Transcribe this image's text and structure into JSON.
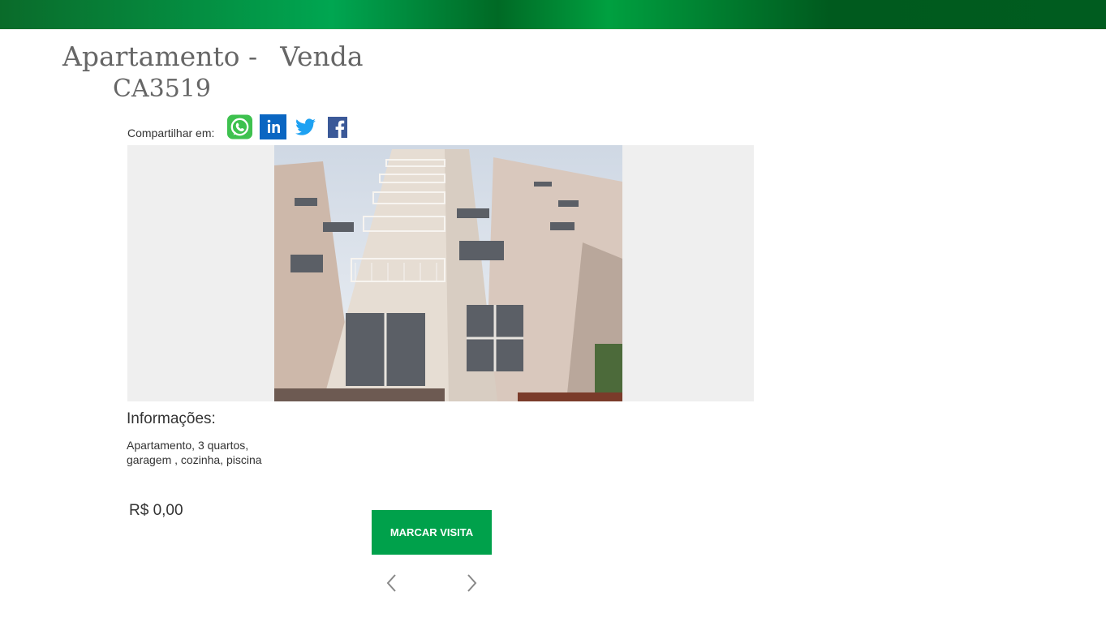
{
  "header": {
    "title_type": "Apartamento -",
    "title_mode": "Venda",
    "code": "CA3519",
    "bar_colors": [
      "#0a6b2a",
      "#00a651",
      "#005c1f"
    ]
  },
  "share": {
    "label": "Compartilhar em:",
    "icons": [
      "whatsapp-icon",
      "linkedin-icon",
      "twitter-icon",
      "facebook-icon"
    ]
  },
  "gallery": {
    "image_alt": "apartment-building-photo",
    "prev_icon": "chevron-left-icon",
    "next_icon": "chevron-right-icon"
  },
  "info": {
    "heading": "Informações:",
    "description": "Apartamento, 3 quartos, garagem , cozinha, piscina"
  },
  "price": "R$ 0,00",
  "cta": {
    "label": "MARCAR VISITA",
    "color": "#00a14b"
  }
}
